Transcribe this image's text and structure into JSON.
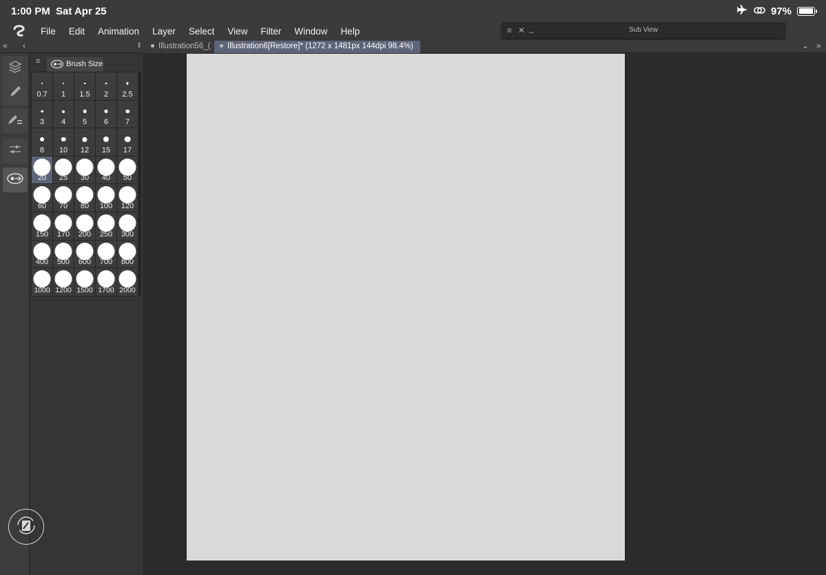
{
  "status": {
    "time": "1:00 PM",
    "date": "Sat Apr 25",
    "battery": "97%",
    "battery_level": 0.97
  },
  "menu": [
    "File",
    "Edit",
    "Animation",
    "Layer",
    "Select",
    "View",
    "Filter",
    "Window",
    "Help"
  ],
  "subview": {
    "title": "Sub View"
  },
  "tabs": [
    {
      "label": "Illustration56_("
    },
    {
      "label": "Illustration6[Restore]* (1272 x 1481px 144dpi 98.4%)"
    }
  ],
  "brush_panel": {
    "title": "Brush Size",
    "sizes": [
      "0.7",
      "1",
      "1.5",
      "2",
      "2.5",
      "3",
      "4",
      "5",
      "6",
      "7",
      "8",
      "10",
      "12",
      "15",
      "17",
      "20",
      "25",
      "30",
      "40",
      "50",
      "60",
      "70",
      "80",
      "100",
      "120",
      "150",
      "170",
      "200",
      "250",
      "300",
      "400",
      "500",
      "600",
      "700",
      "800",
      "1000",
      "1200",
      "1500",
      "1700",
      "2000"
    ],
    "selected": "20"
  },
  "colors": {
    "accent": "#5c6478",
    "panel": "#353535",
    "canvas": "#d9d9d9"
  }
}
